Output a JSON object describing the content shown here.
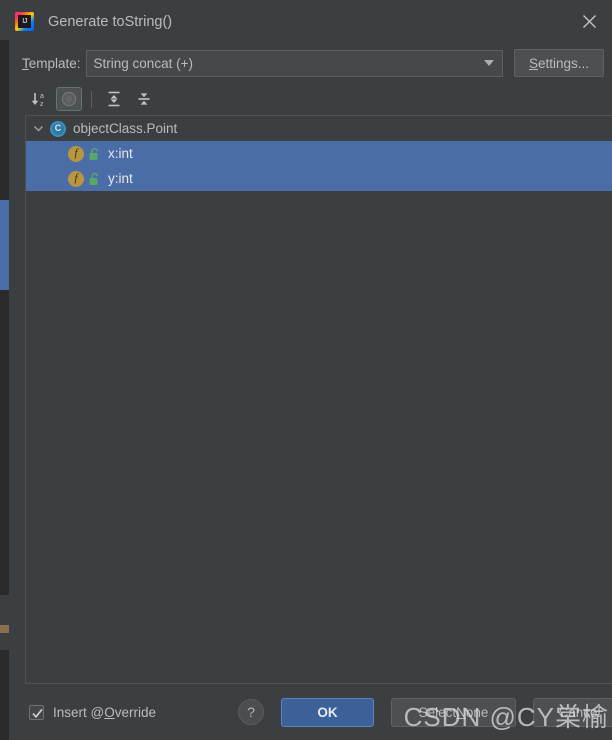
{
  "window": {
    "title": "Generate toString()",
    "app_icon": "intellij-idea-icon",
    "close_icon": "close-icon"
  },
  "template": {
    "label_prefix": "T",
    "label_rest": "emplate:",
    "selected_value": "String concat (+)",
    "dropdown_icon": "chevron-down-icon",
    "settings_prefix": "S",
    "settings_rest": "ettings..."
  },
  "toolbar": {
    "buttons": [
      {
        "name": "sort-alphabetically-button",
        "icon": "sort-az-icon",
        "pressed": false
      },
      {
        "name": "show-inherited-button",
        "icon": "circle-toggle-icon",
        "pressed": true
      },
      {
        "name": "expand-all-button",
        "icon": "expand-all-icon",
        "pressed": false
      },
      {
        "name": "collapse-all-button",
        "icon": "collapse-all-icon",
        "pressed": false
      }
    ]
  },
  "tree": {
    "root": {
      "label": "objectClass.Point",
      "icon": "class-icon",
      "icon_letter": "C",
      "expanded": true,
      "twisty_icon": "chevron-down-icon"
    },
    "fields": [
      {
        "label": "x:int",
        "icon": "field-icon",
        "icon_letter": "f",
        "visibility_icon": "private-lock-icon",
        "selected": true
      },
      {
        "label": "y:int",
        "icon": "field-icon",
        "icon_letter": "f",
        "visibility_icon": "private-lock-icon",
        "selected": true
      }
    ]
  },
  "footer": {
    "insert_override": {
      "checked": true,
      "label_pre": "Insert @",
      "label_mnem": "O",
      "label_post": "verride"
    },
    "help_label": "?",
    "ok_label": "OK",
    "select_none_pre": "Select ",
    "select_none_mnem": "N",
    "select_none_post": "one",
    "cancel_label": "Cancel"
  },
  "watermark": {
    "text": "CSDN @CY棠榆"
  },
  "colors": {
    "dialog_bg": "#3c3f41",
    "selection_blue": "#4a6da7",
    "ok_blue": "#3c6098",
    "class_icon_teal": "#3592c4",
    "field_icon_gold": "#b8953f",
    "lock_green": "#59a869",
    "text": "#bbbbbb"
  }
}
